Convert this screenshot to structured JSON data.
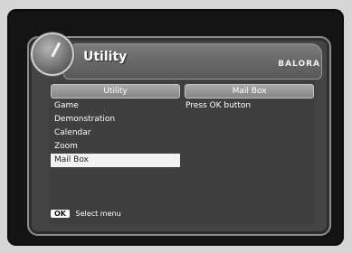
{
  "header": {
    "title": "Utility",
    "brand": "BALORA"
  },
  "columns": {
    "left_title": "Utility",
    "right_title": "Mail Box"
  },
  "menu": {
    "items": [
      {
        "label": "Game"
      },
      {
        "label": "Demonstration"
      },
      {
        "label": "Calendar"
      },
      {
        "label": "Zoom"
      },
      {
        "label": "Mail Box",
        "selected": true
      }
    ]
  },
  "detail": {
    "text": "Press OK button"
  },
  "footer": {
    "key_label": "OK",
    "hint": "Select menu"
  },
  "icons": {
    "dial": "dial-icon"
  }
}
